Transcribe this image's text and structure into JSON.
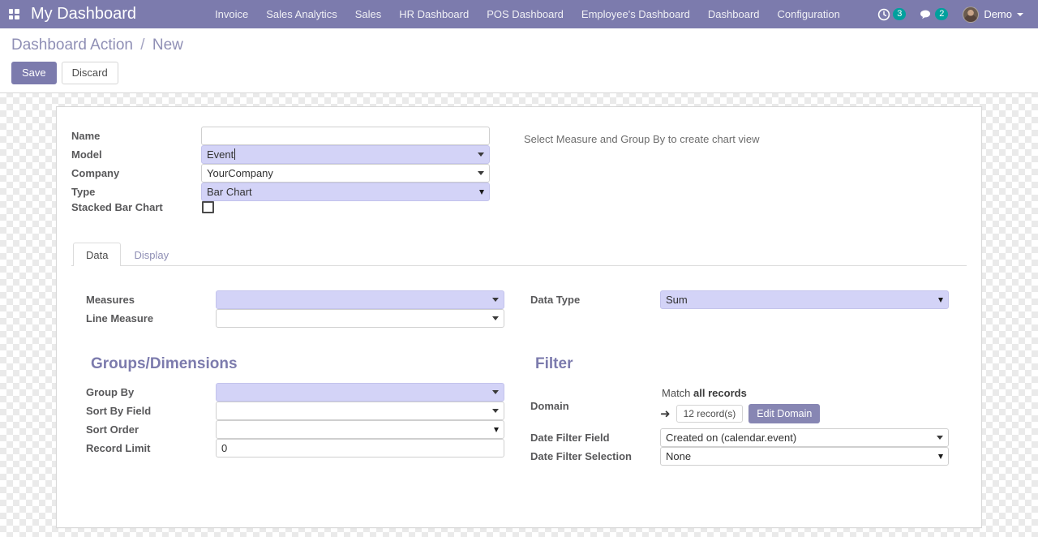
{
  "navbar": {
    "apps_icon": "apps-grid-icon",
    "brand": "My Dashboard",
    "menus": [
      {
        "label": "Invoice"
      },
      {
        "label": "Sales Analytics"
      },
      {
        "label": "Sales"
      },
      {
        "label": "HR Dashboard"
      },
      {
        "label": "POS Dashboard"
      },
      {
        "label": "Employee's Dashboard"
      },
      {
        "label": "Dashboard"
      },
      {
        "label": "Configuration"
      }
    ],
    "activities": {
      "icon": "clock-icon",
      "count": "3"
    },
    "messages": {
      "icon": "chat-bubble-icon",
      "count": "2"
    },
    "user": {
      "name": "Demo",
      "avatar": "user-avatar"
    },
    "accent_color": "#7c7bad",
    "badge_color": "#00a09d"
  },
  "control_panel": {
    "breadcrumb": {
      "parent": "Dashboard Action",
      "separator": "/",
      "current": "New"
    },
    "save_label": "Save",
    "discard_label": "Discard"
  },
  "form": {
    "name": {
      "label": "Name",
      "value": "",
      "placeholder": ""
    },
    "model": {
      "label": "Model",
      "value": "Event",
      "focused": true
    },
    "company": {
      "label": "Company",
      "value": "YourCompany",
      "focused": false
    },
    "type": {
      "label": "Type",
      "value": "Bar Chart",
      "focused": true
    },
    "stacked": {
      "label": "Stacked Bar Chart",
      "checked": false
    },
    "chart_hint": "Select Measure and Group By to create chart view"
  },
  "notebook": {
    "tabs": [
      {
        "label": "Data",
        "active": true
      },
      {
        "label": "Display",
        "active": false
      }
    ]
  },
  "data_tab": {
    "measures": {
      "label": "Measures",
      "value": "",
      "focused": true
    },
    "line_measure": {
      "label": "Line Measure",
      "value": "",
      "focused": false
    },
    "data_type": {
      "label": "Data Type",
      "value": "Sum",
      "focused": true
    },
    "groups_section": {
      "title": "Groups/Dimensions",
      "group_by": {
        "label": "Group By",
        "value": "",
        "focused": true
      },
      "sort_by_field": {
        "label": "Sort By Field",
        "value": "",
        "focused": false
      },
      "sort_order": {
        "label": "Sort Order",
        "value": "",
        "focused": false
      },
      "record_limit": {
        "label": "Record Limit",
        "value": "0",
        "focused": false
      }
    },
    "filter_section": {
      "title": "Filter",
      "domain": {
        "label": "Domain",
        "match_prefix": "Match",
        "match_value": "all records",
        "arrow": "arrow-right-icon",
        "record_count": "12 record(s)",
        "edit_button": "Edit Domain"
      },
      "date_filter_field": {
        "label": "Date Filter Field",
        "value": "Created on (calendar.event)",
        "focused": false
      },
      "date_filter_selection": {
        "label": "Date Filter Selection",
        "value": "None",
        "focused": false
      }
    }
  }
}
